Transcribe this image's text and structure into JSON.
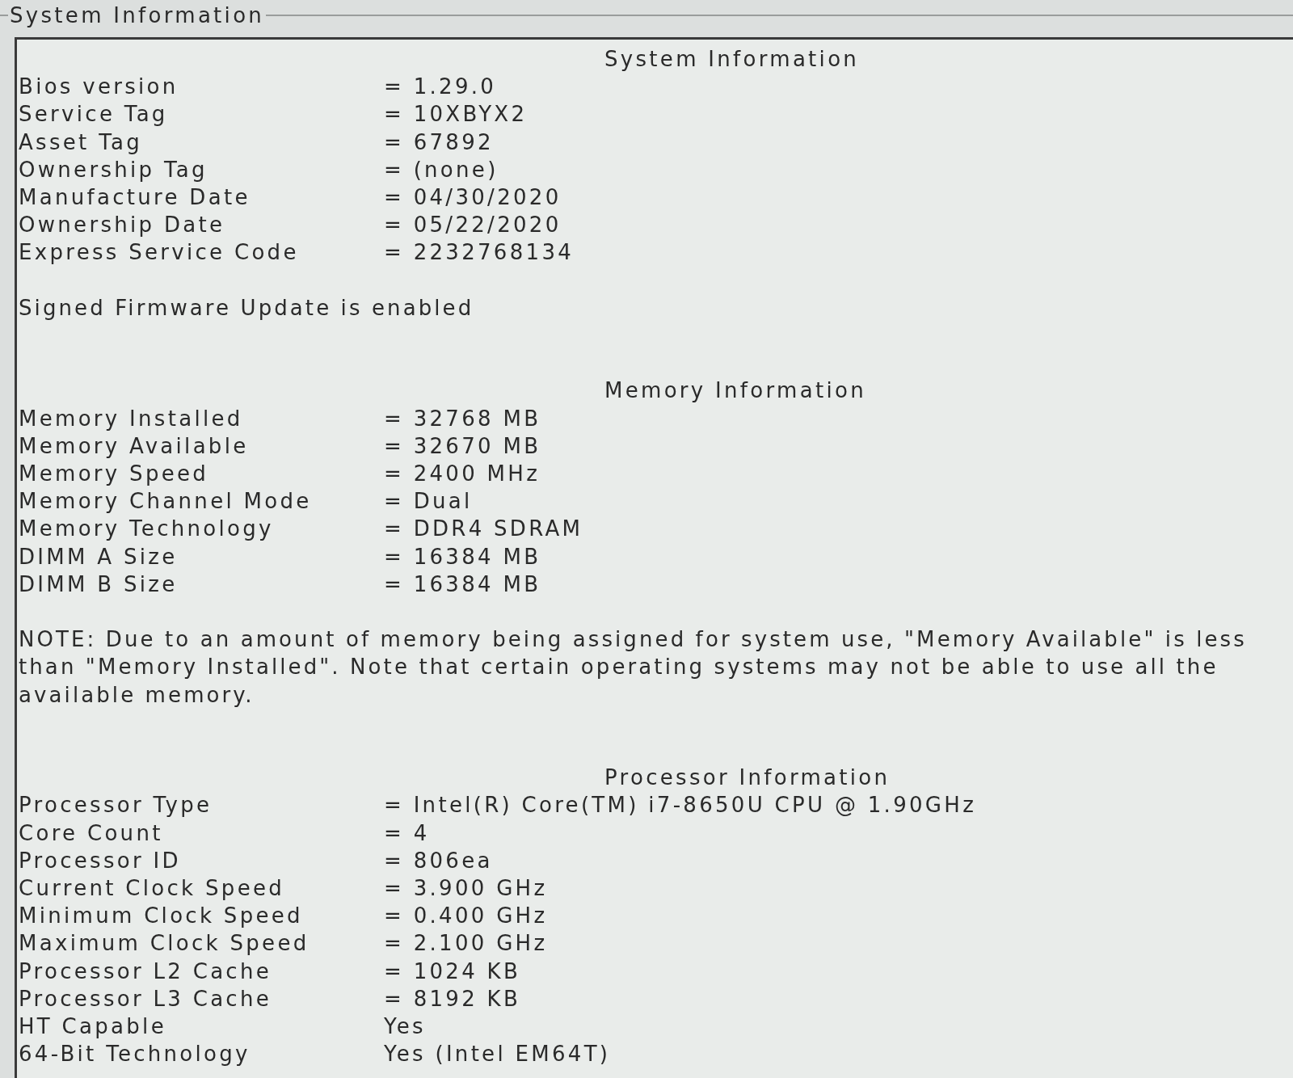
{
  "groupbox": {
    "title": "System Information"
  },
  "sections": [
    {
      "title": "System Information",
      "rows": [
        {
          "label": "Bios version",
          "value": "= 1.29.0"
        },
        {
          "label": "Service Tag",
          "value": "= 10XBYX2"
        },
        {
          "label": "Asset Tag",
          "value": "= 67892"
        },
        {
          "label": "Ownership Tag",
          "value": "= (none)"
        },
        {
          "label": "Manufacture Date",
          "value": "= 04/30/2020"
        },
        {
          "label": "Ownership Date",
          "value": "= 05/22/2020"
        },
        {
          "label": "Express Service Code",
          "value": "= 2232768134"
        }
      ],
      "note": "Signed Firmware Update is enabled"
    },
    {
      "title": "Memory Information",
      "rows": [
        {
          "label": "Memory Installed",
          "value": "= 32768 MB"
        },
        {
          "label": "Memory Available",
          "value": "= 32670 MB"
        },
        {
          "label": "Memory Speed",
          "value": "= 2400 MHz"
        },
        {
          "label": "Memory Channel Mode",
          "value": "= Dual"
        },
        {
          "label": "Memory Technology",
          "value": "= DDR4 SDRAM"
        },
        {
          "label": "DIMM A Size",
          "value": "= 16384 MB"
        },
        {
          "label": "DIMM B Size",
          "value": "= 16384 MB"
        }
      ],
      "note": "NOTE: Due to an amount of memory being assigned for system use, \"Memory Available\" is less than \"Memory Installed\". Note that certain operating systems may not be able to use all the available memory."
    },
    {
      "title": "Processor Information",
      "rows": [
        {
          "label": "Processor Type",
          "value": "= Intel(R) Core(TM) i7-8650U CPU @ 1.90GHz"
        },
        {
          "label": "Core Count",
          "value": "= 4"
        },
        {
          "label": "Processor ID",
          "value": "= 806ea"
        },
        {
          "label": "Current Clock Speed",
          "value": "= 3.900 GHz"
        },
        {
          "label": "Minimum Clock Speed",
          "value": "= 0.400 GHz"
        },
        {
          "label": "Maximum Clock Speed",
          "value": "= 2.100 GHz"
        },
        {
          "label": "Processor L2 Cache",
          "value": "= 1024 KB"
        },
        {
          "label": "Processor L3 Cache",
          "value": "= 8192 KB"
        },
        {
          "label": "HT Capable",
          "value": "Yes"
        },
        {
          "label": "64-Bit Technology",
          "value": "Yes (Intel EM64T)"
        }
      ]
    }
  ]
}
